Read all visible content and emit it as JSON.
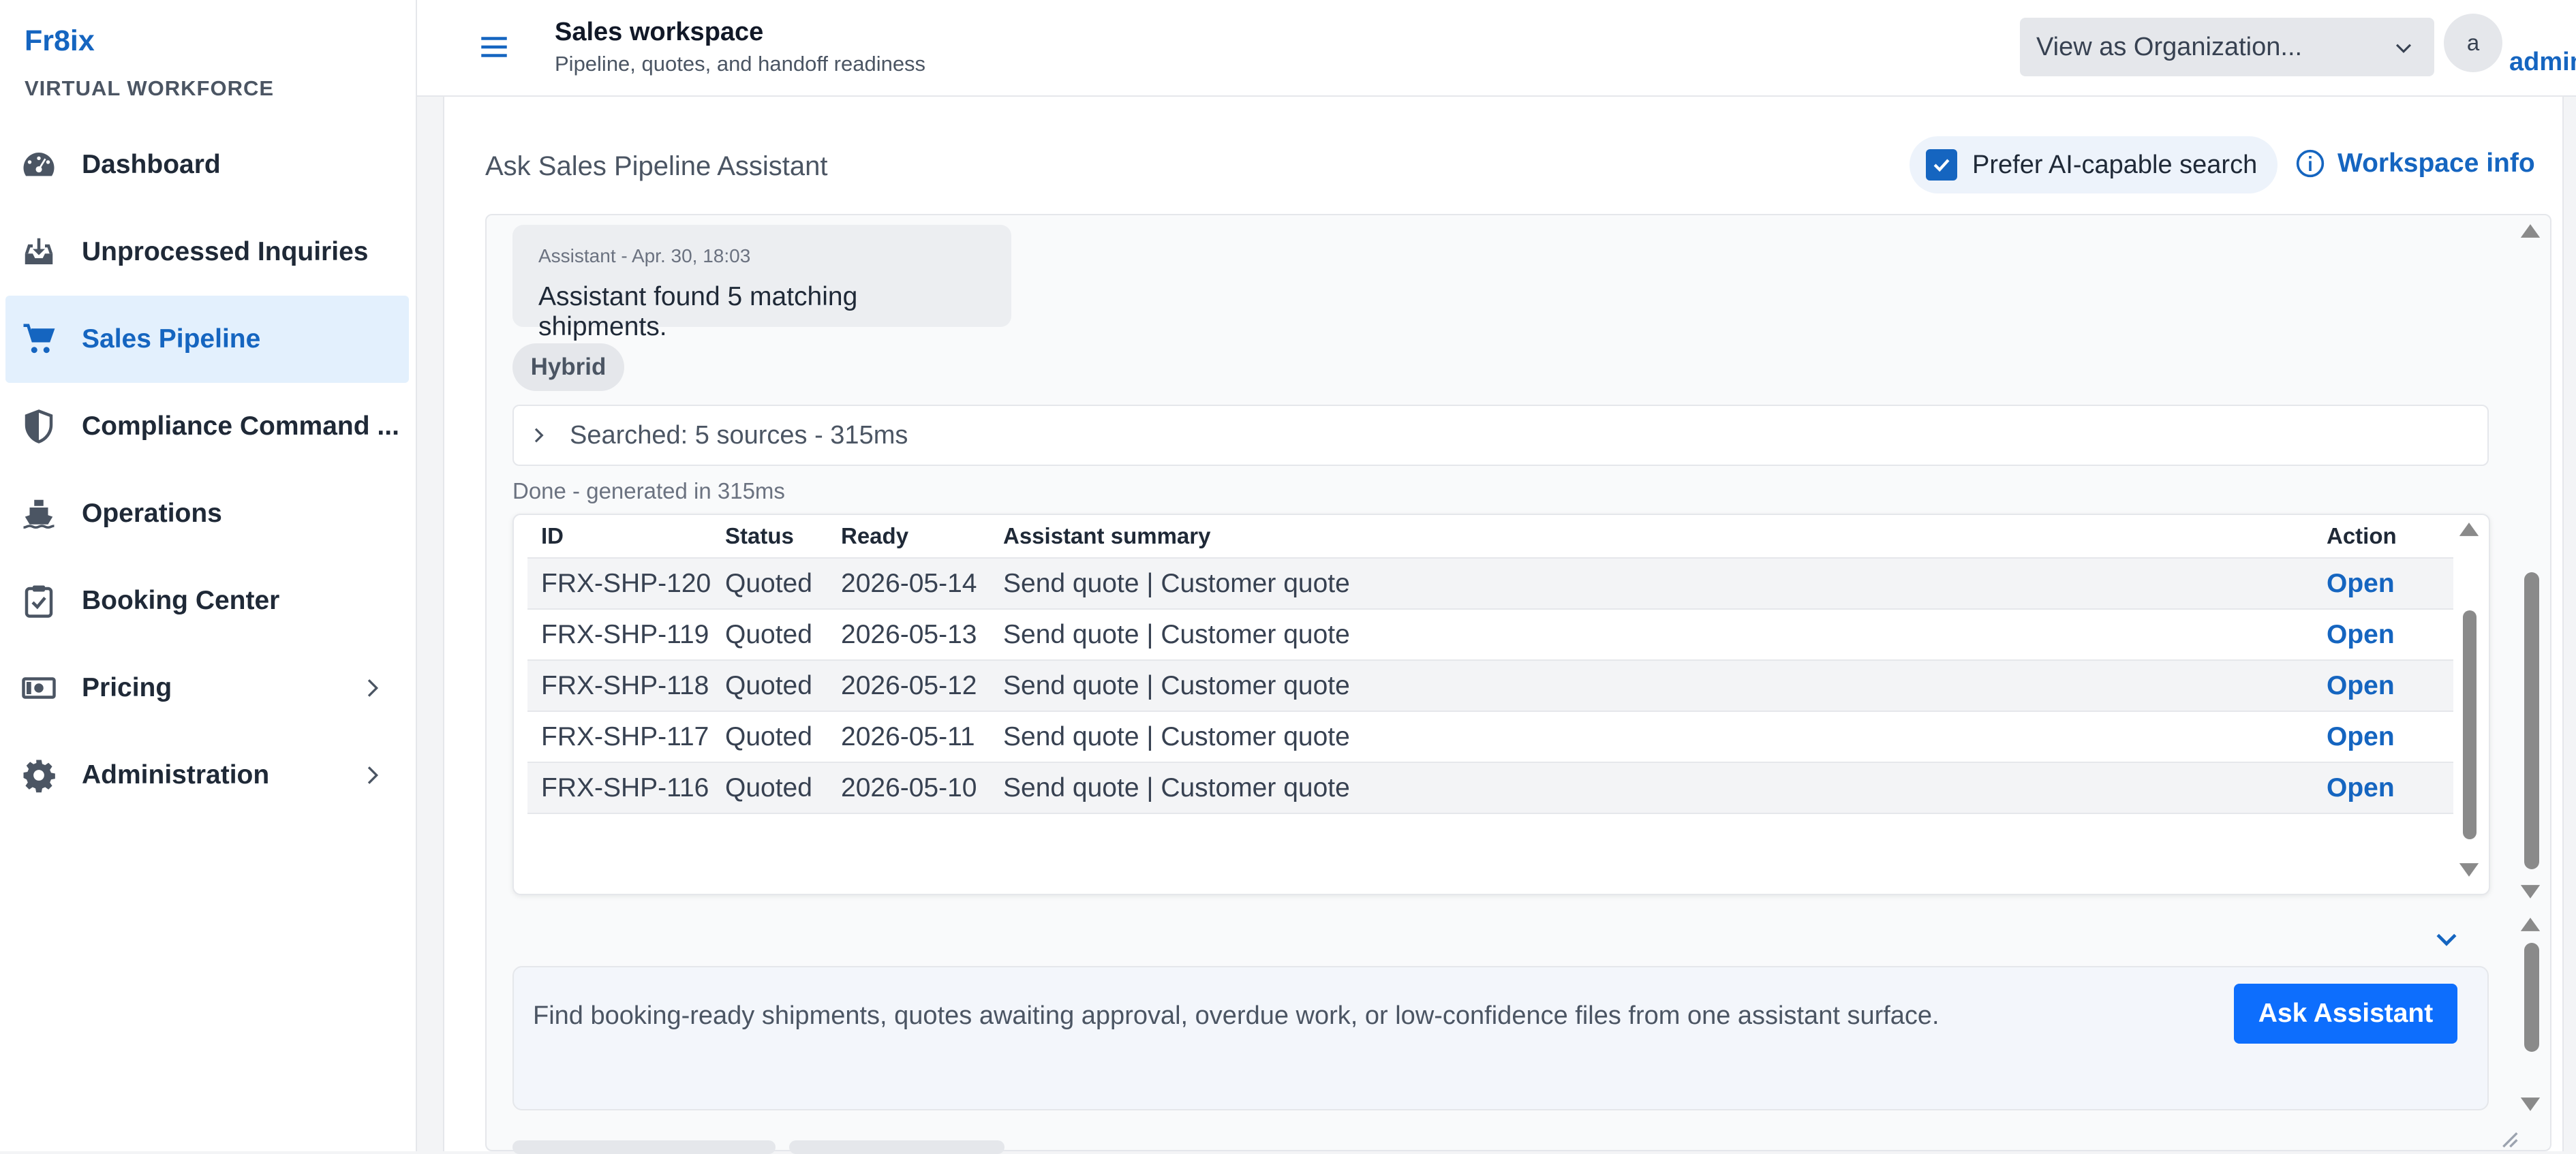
{
  "sidebar": {
    "brand": "Fr8ix",
    "subtitle": "VIRTUAL WORKFORCE",
    "items": [
      {
        "label": "Dashboard",
        "icon": "dashboard-icon"
      },
      {
        "label": "Unprocessed Inquiries",
        "icon": "inbox-download-icon"
      },
      {
        "label": "Sales Pipeline",
        "icon": "cart-icon",
        "active": true
      },
      {
        "label": "Compliance Command ...",
        "icon": "shield-icon"
      },
      {
        "label": "Operations",
        "icon": "ship-icon"
      },
      {
        "label": "Booking Center",
        "icon": "clipboard-check-icon"
      },
      {
        "label": "Pricing",
        "icon": "money-icon",
        "expandable": true
      },
      {
        "label": "Administration",
        "icon": "gear-icon",
        "expandable": true
      }
    ]
  },
  "header": {
    "title": "Sales workspace",
    "subtitle": "Pipeline, quotes, and handoff readiness",
    "org_select_value": "View as Organization...",
    "avatar_initial": "a",
    "user_label": "admin"
  },
  "assistant": {
    "title": "Ask Sales Pipeline Assistant",
    "prefer_ai_label": "Prefer AI-capable search",
    "prefer_ai_checked": true,
    "workspace_info_label": "Workspace info",
    "message_meta": "Assistant - Apr. 30, 18:03",
    "message_text": "Assistant found 5 matching shipments.",
    "mode_tag": "Hybrid",
    "sources_summary": "Searched: 5 sources - 315ms",
    "done_text": "Done - generated in 315ms",
    "table": {
      "columns": [
        "ID",
        "Status",
        "Ready",
        "Assistant summary",
        "Action"
      ],
      "rows": [
        {
          "id": "FRX-SHP-120",
          "status": "Quoted",
          "ready": "2026-05-14",
          "summary": "Send quote | Customer quote",
          "action": "Open"
        },
        {
          "id": "FRX-SHP-119",
          "status": "Quoted",
          "ready": "2026-05-13",
          "summary": "Send quote | Customer quote",
          "action": "Open"
        },
        {
          "id": "FRX-SHP-118",
          "status": "Quoted",
          "ready": "2026-05-12",
          "summary": "Send quote | Customer quote",
          "action": "Open"
        },
        {
          "id": "FRX-SHP-117",
          "status": "Quoted",
          "ready": "2026-05-11",
          "summary": "Send quote | Customer quote",
          "action": "Open"
        },
        {
          "id": "FRX-SHP-116",
          "status": "Quoted",
          "ready": "2026-05-10",
          "summary": "Send quote | Customer quote",
          "action": "Open"
        }
      ]
    },
    "composer_placeholder": "Find booking-ready shipments, quotes awaiting approval, overdue work, or low-confidence files from one assistant surface.",
    "ask_button_label": "Ask Assistant"
  },
  "colors": {
    "accent": "#1565c0",
    "primary_button": "#0d6efd",
    "active_nav_bg": "#e3f0fd"
  }
}
